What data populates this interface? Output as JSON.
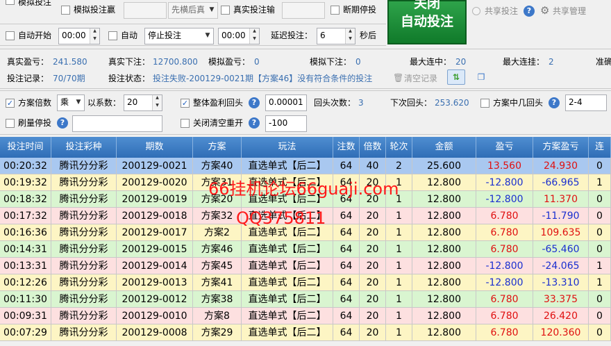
{
  "top": {
    "sim_bet_label": "模拟投注",
    "sim_win_label": "模拟投注赢",
    "order_select": "先横后真",
    "real_loss_label": "真实投注输",
    "break_stop_label": "断期停投",
    "auto_start_label": "自动开始",
    "auto_start_time": "00:00",
    "auto_label": "自动",
    "auto_action": "停止投注",
    "auto_time": "00:00",
    "delay_label": "延迟投注：",
    "delay_value": "6",
    "delay_unit": "秒后",
    "big_button_line1": "关闭",
    "big_button_line2": "自动投注",
    "share_bet_label": "共享投注",
    "share_manage_label": "共享管理"
  },
  "stats": {
    "real_profit_label": "真实盈亏：",
    "real_profit": "241.580",
    "real_bet_label": "真实下注：",
    "real_bet": "12700.800",
    "sim_profit_label": "模拟盈亏：",
    "sim_profit": "0",
    "sim_bet_label": "模拟下注：",
    "sim_bet": "0",
    "max_hit_label": "最大连中：",
    "max_hit": "20",
    "max_miss_label": "最大连挂：",
    "max_miss": "2",
    "accuracy_label": "准确",
    "record_label": "投注记录：",
    "record": "70/70期",
    "status_label": "投注状态：",
    "status": "投注失败-200129-0021期【方案46】没有符合条件的投注",
    "clear_label": "清空记录"
  },
  "options": {
    "multiplier_label": "方案倍数",
    "op_select": "乘",
    "coef_label": "以系数：",
    "coef_value": "20",
    "overall_label": "整体盈利回头",
    "overall_value": "0.00001",
    "back_count_label": "回头次数：",
    "back_count": "3",
    "next_back_label": "下次回头：",
    "next_back": "253.620",
    "plan_hit_label": "方案中几回头",
    "plan_hit_value": "2-4",
    "flush_stop_label": "刷量停投",
    "close_empty_label": "关闭清空重开",
    "close_empty_value": "-100"
  },
  "table": {
    "headers": [
      "投注时间",
      "投注彩种",
      "期数",
      "方案",
      "玩法",
      "注数",
      "倍数",
      "轮次",
      "金额",
      "盈亏",
      "方案盈亏",
      "连"
    ],
    "rows": [
      [
        "00:20:32",
        "腾讯分分彩",
        "200129-0021",
        "方案40",
        "直选单式【后二】",
        "64",
        "40",
        "2",
        "25.600",
        "13.560",
        "24.930",
        "0"
      ],
      [
        "00:19:32",
        "腾讯分分彩",
        "200129-0020",
        "方案31",
        "直选单式【后二】",
        "64",
        "20",
        "1",
        "12.800",
        "-12.800",
        "-66.965",
        "1"
      ],
      [
        "00:18:32",
        "腾讯分分彩",
        "200129-0019",
        "方案20",
        "直选单式【后二】",
        "64",
        "20",
        "1",
        "12.800",
        "-12.800",
        "11.370",
        "0"
      ],
      [
        "00:17:32",
        "腾讯分分彩",
        "200129-0018",
        "方案32",
        "直选单式【后二】",
        "64",
        "20",
        "1",
        "12.800",
        "6.780",
        "-11.790",
        "0"
      ],
      [
        "00:16:36",
        "腾讯分分彩",
        "200129-0017",
        "方案2",
        "直选单式【后二】",
        "64",
        "20",
        "1",
        "12.800",
        "6.780",
        "109.635",
        "0"
      ],
      [
        "00:14:31",
        "腾讯分分彩",
        "200129-0015",
        "方案46",
        "直选单式【后二】",
        "64",
        "20",
        "1",
        "12.800",
        "6.780",
        "-65.460",
        "0"
      ],
      [
        "00:13:31",
        "腾讯分分彩",
        "200129-0014",
        "方案45",
        "直选单式【后二】",
        "64",
        "20",
        "1",
        "12.800",
        "-12.800",
        "-24.065",
        "1"
      ],
      [
        "00:12:26",
        "腾讯分分彩",
        "200129-0013",
        "方案41",
        "直选单式【后二】",
        "64",
        "20",
        "1",
        "12.800",
        "-12.800",
        "-13.310",
        "1"
      ],
      [
        "00:11:30",
        "腾讯分分彩",
        "200129-0012",
        "方案38",
        "直选单式【后二】",
        "64",
        "20",
        "1",
        "12.800",
        "6.780",
        "33.375",
        "0"
      ],
      [
        "00:09:31",
        "腾讯分分彩",
        "200129-0010",
        "方案8",
        "直选单式【后二】",
        "64",
        "20",
        "1",
        "12.800",
        "6.780",
        "26.420",
        "0"
      ],
      [
        "00:07:29",
        "腾讯分分彩",
        "200129-0008",
        "方案29",
        "直选单式【后二】",
        "64",
        "20",
        "1",
        "12.800",
        "6.780",
        "120.360",
        "0"
      ]
    ],
    "row_colors": [
      "#a9c8f0",
      "#fdf5c4",
      "#d9f5d0",
      "#fde0e0",
      "#fdf5c4",
      "#d9f5d0",
      "#fde0e0",
      "#fdf5c4",
      "#d9f5d0",
      "#fde0e0",
      "#fdf5c4"
    ]
  },
  "watermark": {
    "line1": "66挂机论坛66guaji.com",
    "line2": "QQ375811"
  }
}
